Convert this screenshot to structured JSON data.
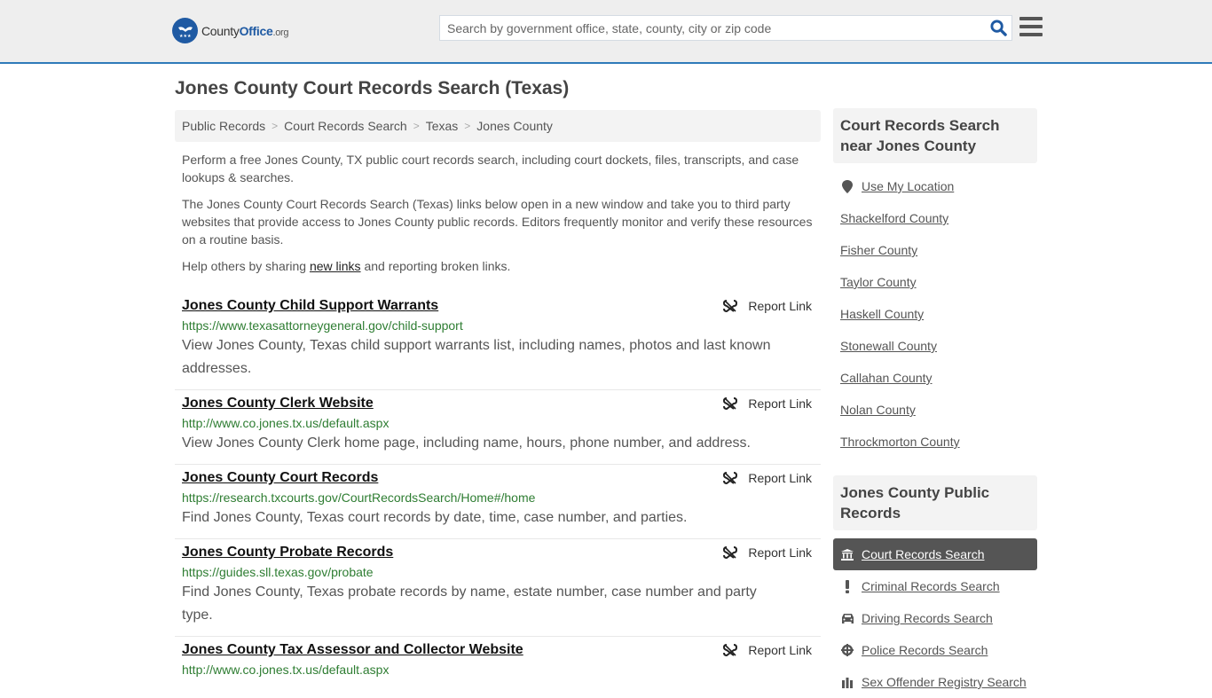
{
  "header": {
    "logo": {
      "county": "County",
      "office": "Office",
      "org": ".org"
    },
    "search": {
      "placeholder": "Search by government office, state, county, city or zip code",
      "value": ""
    },
    "brand_color": "#1f5aa3",
    "accent_border": "#2f7ab9"
  },
  "page": {
    "title": "Jones County Court Records Search (Texas)"
  },
  "breadcrumb": [
    {
      "label": "Public Records"
    },
    {
      "label": "Court Records Search"
    },
    {
      "label": "Texas"
    },
    {
      "label": "Jones County"
    }
  ],
  "intro": {
    "p1": "Perform a free Jones County, TX public court records search, including court dockets, files, transcripts, and case lookups & searches.",
    "p2": "The Jones County Court Records Search (Texas) links below open in a new window and take you to third party websites that provide access to Jones County public records. Editors frequently monitor and verify these resources on a routine basis.",
    "p3_before": "Help others by sharing ",
    "p3_link": "new links",
    "p3_after": " and reporting broken links."
  },
  "results": [
    {
      "title": "Jones County Child Support Warrants",
      "url": "https://www.texasattorneygeneral.gov/child-support",
      "description": "View Jones County, Texas child support warrants list, including names, photos and last known addresses.",
      "report_label": "Report Link"
    },
    {
      "title": "Jones County Clerk Website",
      "url": "http://www.co.jones.tx.us/default.aspx",
      "description": "View Jones County Clerk home page, including name, hours, phone number, and address.",
      "report_label": "Report Link"
    },
    {
      "title": "Jones County Court Records",
      "url": "https://research.txcourts.gov/CourtRecordsSearch/Home#/home",
      "description": "Find Jones County, Texas court records by date, time, case number, and parties.",
      "report_label": "Report Link"
    },
    {
      "title": "Jones County Probate Records",
      "url": "https://guides.sll.texas.gov/probate",
      "description": "Find Jones County, Texas probate records by name, estate number, case number and party type.",
      "report_label": "Report Link"
    },
    {
      "title": "Jones County Tax Assessor and Collector Website",
      "url": "http://www.co.jones.tx.us/default.aspx",
      "description": "",
      "report_label": "Report Link"
    }
  ],
  "sidebar": {
    "nearby_heading": "Court Records Search near Jones County",
    "use_location": "Use My Location",
    "nearby": [
      "Shackelford County",
      "Fisher County",
      "Taylor County",
      "Haskell County",
      "Stonewall County",
      "Callahan County",
      "Nolan County",
      "Throckmorton County"
    ],
    "public_heading": "Jones County Public Records",
    "public_records": [
      {
        "label": "Court Records Search",
        "icon": "courthouse-icon",
        "active": true
      },
      {
        "label": "Criminal Records Search",
        "icon": "exclamation-icon",
        "active": false
      },
      {
        "label": "Driving Records Search",
        "icon": "car-icon",
        "active": false
      },
      {
        "label": "Police Records Search",
        "icon": "crosshair-icon",
        "active": false
      },
      {
        "label": "Sex Offender Registry Search",
        "icon": "group-icon",
        "active": false
      }
    ]
  }
}
